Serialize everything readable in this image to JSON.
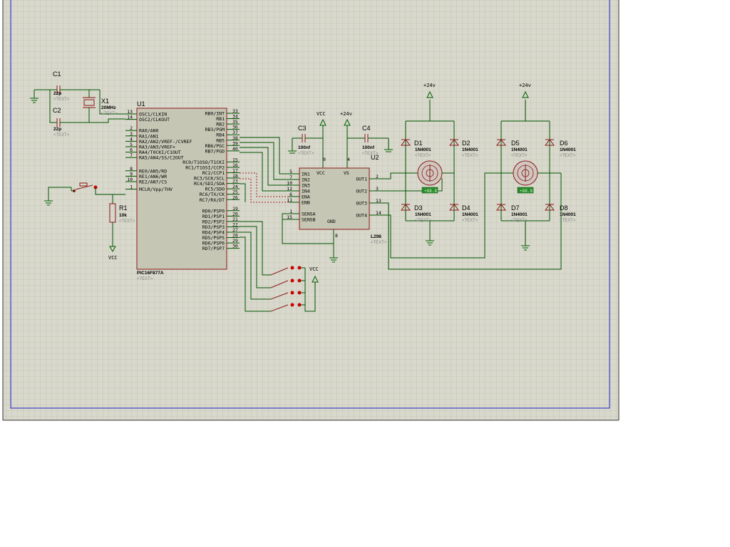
{
  "schematic": {
    "c1": {
      "ref": "C1",
      "value": "22p",
      "text": "<TEXT>"
    },
    "c2": {
      "ref": "C2",
      "value": "22p",
      "text": "<TEXT>"
    },
    "x1": {
      "ref": "X1",
      "value": "20MHz",
      "text": "<TEXT>"
    },
    "u1": {
      "ref": "U1",
      "part": "PIC16F877A",
      "text": "<TEXT>",
      "left_pins": [
        {
          "num": "13",
          "name": "OSC1/CLKIN"
        },
        {
          "num": "14",
          "name": "OSC2/CLKOUT"
        },
        {
          "num": "2",
          "name": "RA0/AN0"
        },
        {
          "num": "3",
          "name": "RA1/AN1"
        },
        {
          "num": "4",
          "name": "RA2/AN2/VREF-/CVREF"
        },
        {
          "num": "5",
          "name": "RA3/AN3/VREF+"
        },
        {
          "num": "6",
          "name": "RA4/T0CKI/C1OUT"
        },
        {
          "num": "7",
          "name": "RA5/AN4/SS/C2OUT"
        },
        {
          "num": "8",
          "name": "RE0/AN5/RD"
        },
        {
          "num": "9",
          "name": "RE1/AN6/WR"
        },
        {
          "num": "10",
          "name": "RE2/AN7/CS"
        },
        {
          "num": "1",
          "name": "MCLR/Vpp/THV"
        }
      ],
      "right_pins": [
        {
          "num": "33",
          "name": "RB0/INT"
        },
        {
          "num": "34",
          "name": "RB1"
        },
        {
          "num": "35",
          "name": "RB2"
        },
        {
          "num": "36",
          "name": "RB3/PGM"
        },
        {
          "num": "37",
          "name": "RB4"
        },
        {
          "num": "38",
          "name": "RB5"
        },
        {
          "num": "39",
          "name": "RB6/PGC"
        },
        {
          "num": "40",
          "name": "RB7/PGD"
        },
        {
          "num": "15",
          "name": "RC0/T1OSO/T1CKI"
        },
        {
          "num": "16",
          "name": "RC1/T1OSI/CCP2"
        },
        {
          "num": "17",
          "name": "RC2/CCP1"
        },
        {
          "num": "18",
          "name": "RC3/SCK/SCL"
        },
        {
          "num": "23",
          "name": "RC4/SDI/SDA"
        },
        {
          "num": "24",
          "name": "RC5/SDO"
        },
        {
          "num": "25",
          "name": "RC6/TX/CK"
        },
        {
          "num": "26",
          "name": "RC7/RX/DT"
        },
        {
          "num": "19",
          "name": "RD0/PSP0"
        },
        {
          "num": "20",
          "name": "RD1/PSP1"
        },
        {
          "num": "21",
          "name": "RD2/PSP2"
        },
        {
          "num": "22",
          "name": "RD3/PSP3"
        },
        {
          "num": "27",
          "name": "RD4/PSP4"
        },
        {
          "num": "28",
          "name": "RD5/PSP5"
        },
        {
          "num": "29",
          "name": "RD6/PSP6"
        },
        {
          "num": "30",
          "name": "RD7/PSP7"
        }
      ]
    },
    "r1": {
      "ref": "R1",
      "value": "10k",
      "text": "<TEXT>"
    },
    "vcc_label": "VCC",
    "v24_label": "+24v",
    "v24_label_b": "+24v",
    "c3": {
      "ref": "C3",
      "value": "100nf",
      "text": "<TEXT>"
    },
    "c4": {
      "ref": "C4",
      "value": "100nf",
      "text": "<TEXT>"
    },
    "u2": {
      "ref": "U2",
      "part": "L298",
      "text": "<TEXT>",
      "left_pins": [
        {
          "num": "5",
          "name": "IN1"
        },
        {
          "num": "7",
          "name": "IN2"
        },
        {
          "num": "10",
          "name": "IN3"
        },
        {
          "num": "12",
          "name": "IN4"
        },
        {
          "num": "6",
          "name": "ENA"
        },
        {
          "num": "11",
          "name": "ENB"
        },
        {
          "num": "1",
          "name": "SENSA"
        },
        {
          "num": "15",
          "name": "SENSB"
        }
      ],
      "right_pins": [
        {
          "num": "2",
          "name": "OUT1"
        },
        {
          "num": "3",
          "name": "OUT2"
        },
        {
          "num": "13",
          "name": "OUT3"
        },
        {
          "num": "14",
          "name": "OUT4"
        }
      ],
      "top_pins": [
        {
          "num": "9",
          "name": "VCC"
        },
        {
          "num": "4",
          "name": "VS"
        }
      ],
      "bottom_pin": {
        "num": "8",
        "name": "GND"
      }
    },
    "diodes": [
      {
        "ref": "D1",
        "value": "1N4001",
        "text": "<TEXT>"
      },
      {
        "ref": "D2",
        "value": "1N4001",
        "text": "<TEXT>"
      },
      {
        "ref": "D3",
        "value": "1N4001",
        "text": "<TEXT>"
      },
      {
        "ref": "D4",
        "value": "1N4001",
        "text": "<TEXT>"
      },
      {
        "ref": "D5",
        "value": "1N4001",
        "text": "<TEXT>"
      },
      {
        "ref": "D6",
        "value": "1N4001",
        "text": "<TEXT>"
      },
      {
        "ref": "D7",
        "value": "1N4001",
        "text": "<TEXT>"
      },
      {
        "ref": "D8",
        "value": "1N4001",
        "text": "<TEXT>"
      }
    ],
    "motor_readout_1": "+88.8",
    "motor_readout_2": "+88.8",
    "colors": {
      "grid_bg": "#d8d8cc",
      "grid_line": "#b7b7a6",
      "border": "#1f1fc8",
      "wire": "#005500",
      "component": "#8b1a1a"
    }
  }
}
